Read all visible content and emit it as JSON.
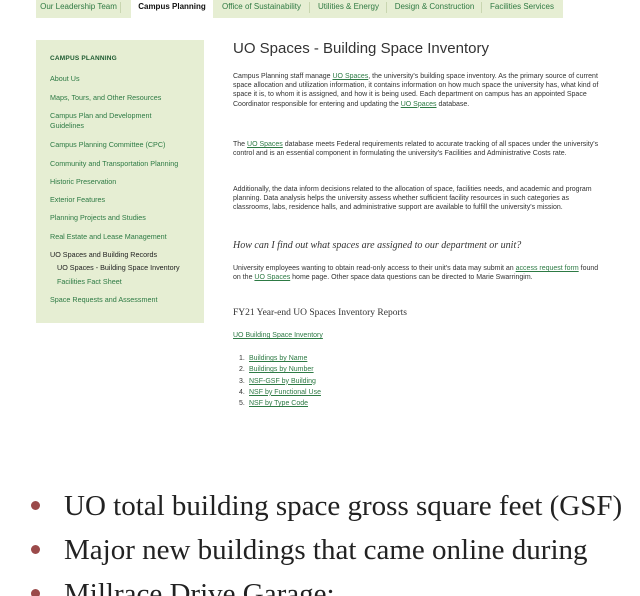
{
  "nav": {
    "tabs": [
      {
        "label": "Our Leadership Team",
        "active": false
      },
      {
        "label": "Campus Planning",
        "active": true
      },
      {
        "label": "Office of Sustainability",
        "active": false
      },
      {
        "label": "Utilities & Energy",
        "active": false
      },
      {
        "label": "Design & Construction",
        "active": false
      },
      {
        "label": "Facilities Services",
        "active": false
      }
    ]
  },
  "sidebar": {
    "heading": "CAMPUS PLANNING",
    "items": [
      {
        "label": "About Us"
      },
      {
        "label": "Maps, Tours, and Other Resources"
      },
      {
        "label": "Campus Plan and Development Guidelines"
      },
      {
        "label": "Campus Planning Committee (CPC)"
      },
      {
        "label": "Community and Transportation Planning"
      },
      {
        "label": "Historic Preservation"
      },
      {
        "label": "Exterior Features"
      },
      {
        "label": "Planning Projects and Studies"
      },
      {
        "label": "Real Estate and Lease Management"
      },
      {
        "label": "UO Spaces and Building Records"
      },
      {
        "label": "UO Spaces - Building Space Inventory"
      },
      {
        "label": "Facilities Fact Sheet"
      },
      {
        "label": "Space Requests and Assessment"
      }
    ]
  },
  "main": {
    "title": "UO Spaces - Building Space Inventory",
    "p1": {
      "a": "Campus Planning staff manage ",
      "link": "UO Spaces",
      "b": ", the university's building space inventory. As the primary source of current space allocation and utilization information, it contains information on how much space the university has, what kind of space it is, to whom it is assigned, and how it is being used. Each department on campus has an appointed Space Coordinator responsible for entering and updating the ",
      "link2": "UO Spaces",
      "c": " database."
    },
    "p2": {
      "a": "The ",
      "link": "UO Spaces",
      "b": " database meets Federal requirements related to accurate tracking of all spaces under the university's control and is an essential component in formulating the university's Facilities and Administrative Costs rate."
    },
    "p3": "Additionally, the data inform decisions related to the allocation of space, facilities needs, and academic and program planning. Data analysis helps the university assess whether sufficient facility resources in such categories as classrooms, labs, residence halls, and administrative support are available to fulfill the university's mission.",
    "question": "How can I find out what spaces are assigned to our department or unit?",
    "p4": {
      "a": "University employees wanting to obtain read-only access to their unit's data may submit an ",
      "link": "access request form",
      "b": " found on the ",
      "link2": "UO Spaces",
      "c": " home page. Other space data questions can be directed to Marie Swarringim."
    },
    "reports_heading": "FY21 Year-end UO Spaces Inventory Reports",
    "inventory_link": "UO Building Space Inventory",
    "reports": [
      {
        "num": "1.",
        "label": "Buildings by Name"
      },
      {
        "num": "2.",
        "label": "Buildings by Number"
      },
      {
        "num": "3.",
        "label": "NSF-GSF by Building"
      },
      {
        "num": "4.",
        "label": "NSF by Functional Use"
      },
      {
        "num": "5.",
        "label": "NSF by Type Code"
      }
    ]
  },
  "bullets": [
    "UO total building space gross square feet (GSF)",
    "Major new buildings that came online during",
    "Millrace Drive Garage:"
  ],
  "colors": {
    "accent_green": "#2d7a44",
    "sidebar_bg": "#e6eed3",
    "bullet_dot": "#9b4a4a"
  }
}
